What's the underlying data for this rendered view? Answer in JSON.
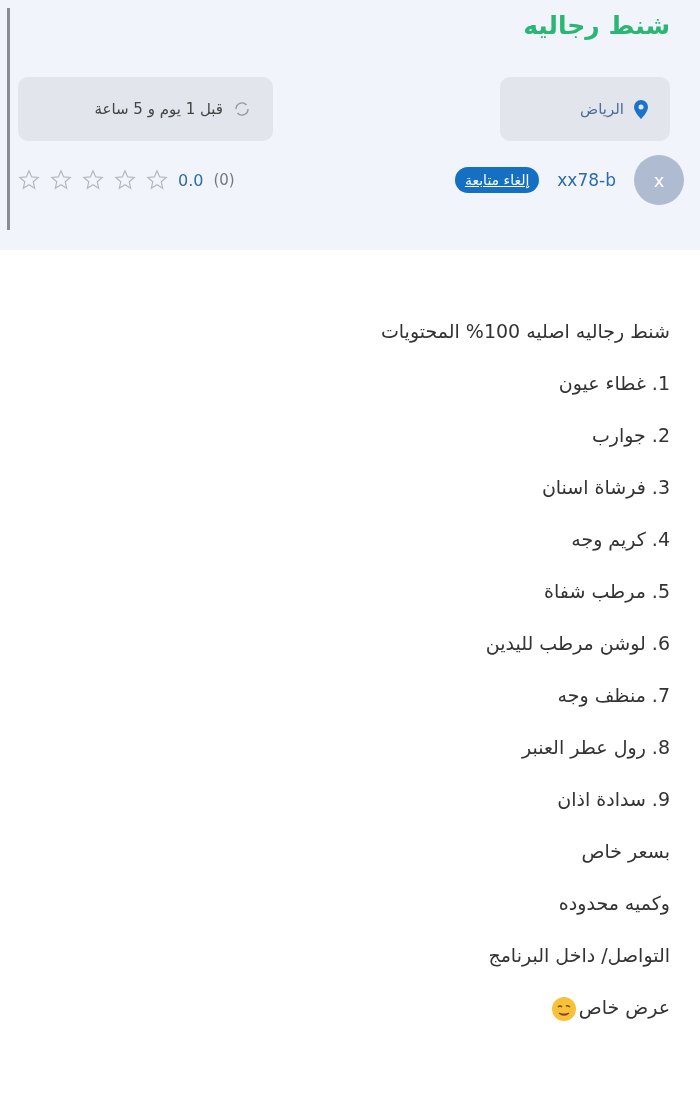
{
  "listing": {
    "title": "شنط رجاليه",
    "location": "الرياض",
    "posted": "قبل 1 يوم و 5 ساعة",
    "seller": {
      "avatar_letter": "x",
      "username": "xx78-b",
      "follow_button": "إلغاء متابعة"
    },
    "rating": {
      "count": "(0)",
      "score": "0.0",
      "stars": 0
    }
  },
  "description": [
    {
      "text": "شنط رجاليه اصليه 100% المحتويات"
    },
    {
      "text": "1. غطاء عيون"
    },
    {
      "text": "2. جوارب"
    },
    {
      "text": "3. فرشاة اسنان"
    },
    {
      "text": "4. كريم وجه"
    },
    {
      "text": "5. مرطب شفاة"
    },
    {
      "text": "6. لوشن مرطب لليدين"
    },
    {
      "text": "7. منظف وجه"
    },
    {
      "text": "8. رول عطر العنبر"
    },
    {
      "text": "9. سدادة اذان"
    },
    {
      "text": "بسعر خاص"
    },
    {
      "text": "وكميه محدوده"
    },
    {
      "text": "التواصل/ داخل البرنامج"
    },
    {
      "text": "عرض خاص",
      "emoji": true
    }
  ]
}
